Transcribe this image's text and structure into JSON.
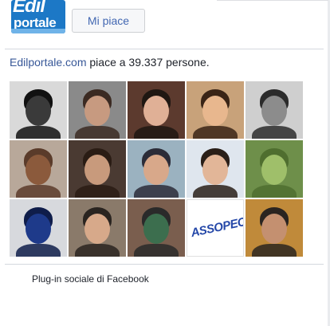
{
  "page": {
    "logo_line1": "Edil",
    "logo_line2": "portale"
  },
  "like_button": {
    "label": "Mi piace"
  },
  "likes_summary": {
    "page_name": "Edilportale.com",
    "text": " piace a 39.337 persone."
  },
  "fans": [
    {
      "name": "fan-1",
      "bg": "#d9d9d9",
      "skin": "#3a3a3a",
      "hair": "#111111"
    },
    {
      "name": "fan-2",
      "bg": "#8a8a8a",
      "skin": "#c79a80",
      "hair": "#3b2a22"
    },
    {
      "name": "fan-3",
      "bg": "#5c3a2e",
      "skin": "#e0b096",
      "hair": "#1f1712"
    },
    {
      "name": "fan-4",
      "bg": "#c8a27a",
      "skin": "#e8b78e",
      "hair": "#3a2416"
    },
    {
      "name": "fan-5",
      "bg": "#cfcfcf",
      "skin": "#8c8c8c",
      "hair": "#2b2b2b"
    },
    {
      "name": "fan-6",
      "bg": "#b8a89a",
      "skin": "#8b5a3c",
      "hair": "#5a3b2a"
    },
    {
      "name": "fan-7",
      "bg": "#4a3a32",
      "skin": "#c89a7c",
      "hair": "#2a1c14"
    },
    {
      "name": "fan-8",
      "bg": "#9bb2c0",
      "skin": "#d8a88a",
      "hair": "#2c2c38"
    },
    {
      "name": "fan-9",
      "bg": "#dfe6ee",
      "skin": "#e2b698",
      "hair": "#2a1f18"
    },
    {
      "name": "fan-10",
      "bg": "#6e8f4a",
      "skin": "#9fbf6a",
      "hair": "#4f6e2f"
    },
    {
      "name": "fan-11",
      "bg": "#d7d9dd",
      "skin": "#1e3a8a",
      "hair": "#0f1d4a"
    },
    {
      "name": "fan-12",
      "bg": "#8a7a6a",
      "skin": "#d7a98a",
      "hair": "#2a2420"
    },
    {
      "name": "fan-13",
      "bg": "#7a5e4e",
      "skin": "#3c6e4e",
      "hair": "#2a2a2a"
    },
    {
      "name": "fan-14",
      "bg": "#ffffff",
      "skin": "#ffffff",
      "hair": "#ffffff",
      "text": "ASSOPEC"
    },
    {
      "name": "fan-15",
      "bg": "#c08a3a",
      "skin": "#c49070",
      "hair": "#2a2420"
    }
  ],
  "footer": {
    "label": "Plug-in sociale di Facebook"
  },
  "colors": {
    "link": "#385898",
    "button_text": "#4267b2",
    "logo_blue": "#1c78c6"
  }
}
